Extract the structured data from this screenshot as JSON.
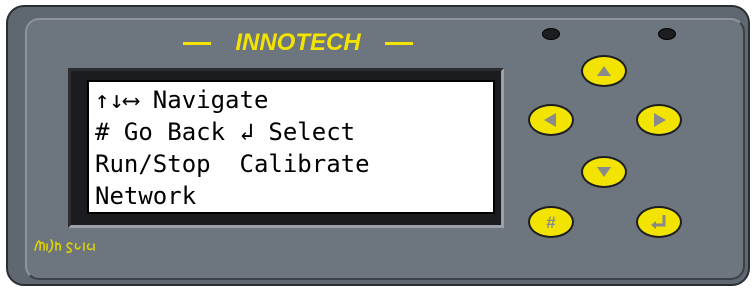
{
  "brand": {
    "name": "INNOTECH"
  },
  "colors": {
    "panel": "#5f6770",
    "accent_yellow": "#f2e300",
    "lcd_background": "#ffffff",
    "lcd_text": "#000000"
  },
  "display": {
    "lines": [
      "↑↓⟷ Navigate",
      "# Go Back ↲ Select",
      "Run/Stop  Calibrate",
      "Network"
    ]
  },
  "keypad": {
    "keys": [
      {
        "icon": "up-arrow-icon"
      },
      {
        "icon": "left-arrow-icon"
      },
      {
        "icon": "right-arrow-icon"
      },
      {
        "icon": "down-arrow-icon"
      },
      {
        "icon": "hash-icon",
        "label": "#"
      },
      {
        "icon": "enter-icon"
      }
    ]
  },
  "indicators": {
    "count": 2
  }
}
